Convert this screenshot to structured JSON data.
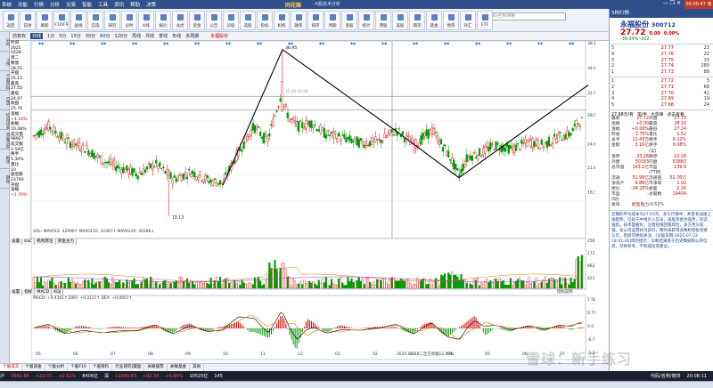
{
  "titlebar": {
    "menus": [
      "系统",
      "功能",
      "行情",
      "分析",
      "交易",
      "智能",
      "工具",
      "资讯",
      "帮助",
      "决策"
    ],
    "brand": "同花顺",
    "subtitle": "- A股技术分析",
    "clock": "00:00:47 收市",
    "controls": "— ❐ ✕"
  },
  "toolbar": {
    "buttons": [
      "返回",
      "前进",
      "刷新",
      "F10/F9",
      "画线",
      "自选",
      "研究",
      "分时",
      "K线",
      "报价",
      "龙虎",
      "资金",
      "公告",
      "诊股",
      "选股",
      "指标",
      "机构",
      "融资",
      "排序",
      "周期",
      "多股",
      "统计",
      "港股",
      "美股",
      "期货",
      "基金",
      "债券",
      "外汇",
      "ETF"
    ],
    "search_placeholder": "代码/名称/简拼"
  },
  "left_strip": [
    "分时",
    "K线",
    "个股资料",
    "自选",
    "综合排名",
    "资金流向",
    "板块",
    "期指"
  ],
  "periodbar": {
    "items": [
      "前复权",
      "日线",
      "1分",
      "5分",
      "15分",
      "30分",
      "60分",
      "120分",
      "周线",
      "月线",
      "季线",
      "年线",
      "多周期"
    ],
    "active_index": 1,
    "stock_tag": "永福股份"
  },
  "infopanel": [
    [
      "时间",
      ""
    ],
    [
      "",
      "2025"
    ],
    [
      "",
      "0228"
    ],
    [
      "",
      "周二"
    ],
    [
      "数值",
      ""
    ],
    [
      "",
      "28.51"
    ],
    [
      "开盘",
      ""
    ],
    [
      "",
      "25.15"
    ],
    [
      "最高",
      ""
    ],
    [
      "",
      "27.55"
    ],
    [
      "最低",
      ""
    ],
    [
      "",
      "24.97"
    ],
    [
      "收盘",
      ""
    ],
    [
      "",
      "25.76"
    ],
    [
      "涨幅",
      ""
    ],
    [
      "",
      "+4.16%"
    ],
    [
      "振幅",
      ""
    ],
    [
      "",
      "10.48%"
    ],
    [
      "成交量",
      ""
    ],
    [
      "",
      "98927"
    ],
    [
      "成交额",
      ""
    ],
    [
      "",
      "2.59亿"
    ],
    [
      "换手",
      ""
    ],
    [
      "",
      "5.30%"
    ],
    [
      "量比",
      ""
    ],
    [
      "",
      "10"
    ],
    [
      "盘后额",
      ""
    ],
    [
      "",
      "23790"
    ],
    [
      "开盘",
      ""
    ],
    [
      "涨幅",
      ""
    ],
    [
      "",
      "+1.70%"
    ]
  ],
  "chart": {
    "price_labels": {
      "high": "36.95",
      "low": "15.13",
      "mid": "31.46-33.98"
    },
    "axis_right": [
      "38.11",
      "34.82",
      "31.52",
      "28.53",
      "24.69",
      "21.60",
      "18.31"
    ],
    "volume_axis": [
      "2567",
      "1724",
      "862",
      "421"
    ],
    "volume_legend": "VOL: MAVOL5: 42990↑ MAVOL10: 32367↑ MAVOL20: 40286↓",
    "macd_legend": "MACD: +0.4161↑ DIFF: +0.3111↑ DEA: +0.0951↑",
    "macd_axis": [
      "1.50",
      "0.778",
      "0.0",
      "-0.778",
      "-1.25"
    ],
    "index_button": "指标说明",
    "note": "2025-02-18二至交易幅12.09%",
    "month_labels": [
      "05",
      "06",
      "07",
      "08",
      "09",
      "10",
      "11",
      "12",
      "01",
      "02",
      "03",
      "04",
      "05",
      "06",
      "07"
    ]
  },
  "chart_tabs": [
    "设置",
    "ESC",
    "机构席位",
    "资金主力"
  ],
  "macd_tabs": [
    "设置",
    "指标",
    "MACD",
    "KDJ"
  ],
  "bottom_tabs": [
    "个股成交",
    "个股资金",
    "个股分析",
    "个股F10",
    "个股资料",
    "行业研究|键盘",
    "关联股票",
    "关联基金",
    "其他"
  ],
  "status": {
    "index1_name": "沪",
    "index1_value": "3581.86",
    "index1_change": "+22.07",
    "index1_pct": "+0.62%",
    "index1_amt": "8406亿",
    "index2_name": "深",
    "index2_value": "11099.83",
    "index2_change": "+92.34",
    "index2_pct": "+0.84%",
    "index2_amt": "10525亿",
    "index3_value": "145",
    "right_info": "代码/名称/简拼",
    "time": "20:08:11"
  },
  "rpanel": {
    "header": "5档行情",
    "name": "永福股份",
    "code": "300712",
    "price": "27.72",
    "change": "0.00",
    "pct": "0.00%",
    "metrics_line": "-39.04% -202",
    "asks": [
      [
        "5",
        "27.77",
        "23"
      ],
      [
        "4",
        "27.76",
        "22"
      ],
      [
        "3",
        "27.75",
        "33"
      ],
      [
        "2",
        "27.74",
        "280"
      ],
      [
        "1",
        "27.73",
        "88"
      ]
    ],
    "bids": [
      [
        "1",
        "27.72",
        "5"
      ],
      [
        "2",
        "27.71",
        "68"
      ],
      [
        "3",
        "27.70",
        "42"
      ],
      [
        "4",
        "27.69",
        "19"
      ],
      [
        "5",
        "27.68",
        "24"
      ]
    ],
    "subheader": [
      "27.68元/有",
      "笔/手",
      "大宗单",
      "点击查看"
    ],
    "stats": [
      [
        "最新",
        "27.72",
        "开盘",
        "27.73"
      ],
      [
        "涨跌",
        "+0.00",
        "最高",
        "28.10"
      ],
      [
        "涨幅",
        "+0.00%",
        "最低",
        "27.14"
      ],
      [
        "昨收",
        "3.75%",
        "量比",
        "1.52"
      ],
      [
        "总手",
        "11.43万",
        "换手",
        "6.12%"
      ],
      [
        "金额",
        "3.16亿",
        "换手(实)",
        "6.08%"
      ],
      [
        "涨停",
        "33.26",
        "跌停",
        "22.18"
      ],
      [
        "外盘",
        "50393",
        "内盘",
        "63883"
      ],
      [
        "总市值",
        "143.2亿",
        "市盈(TTM)",
        "139.9"
      ],
      [
        "流通",
        "51.99亿",
        "流通值",
        "51.76亿"
      ],
      [
        "净资产",
        "9.88亿",
        "市净率",
        "1.92"
      ],
      [
        "委比",
        "-24.26%",
        "委差",
        "-2.16"
      ],
      [
        "市盈(动)",
        "-",
        "总股数",
        "19404"
      ],
      [
        "板块",
        "新型电力",
        "-0.51%",
        ""
      ]
    ],
    "news": "近期的平均成本为27.63元。多头行情中，并且有加速上涨趋势。已处于中线买入信号，该股资金为强势，形态强劲。技术面看好，注意短线回落风险，多方势头较强。该公司运营状况良好，暂时未获得多数机构投资者认可，后续可继续关注。[诊股日期:2025-07-22 18:41:46]风险提示：诊断结果基于历史数据和公开信息，仅供参考，不构成投资建议。",
    "news_more": "查看"
  },
  "watermark": "雪球：新手练习",
  "colors": {
    "up": "#d40000",
    "down": "#009900",
    "macd_dif": "#000000",
    "macd_dea": "#e07b00",
    "trend": "#000000"
  }
}
